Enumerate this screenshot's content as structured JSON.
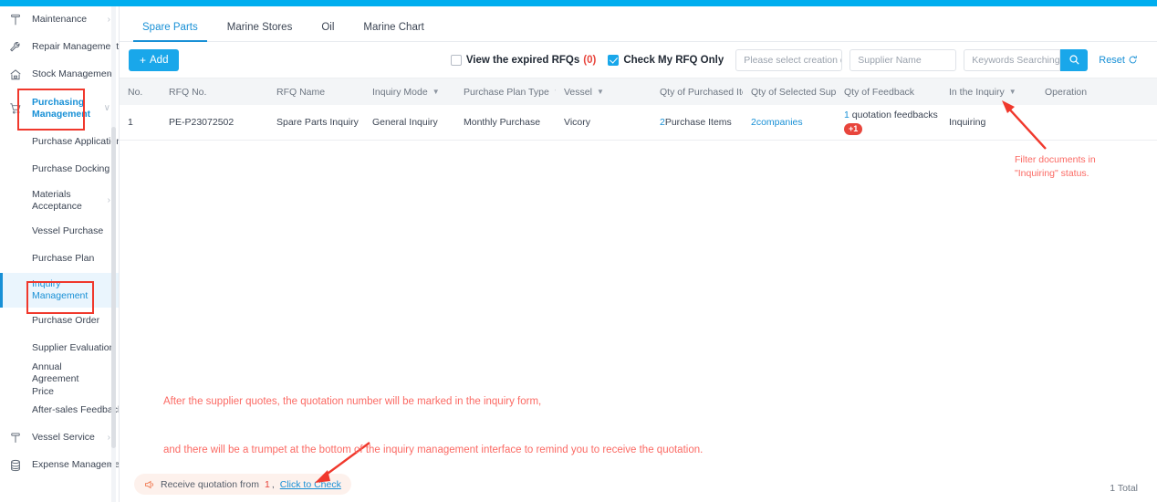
{
  "theme": {
    "accent": "#1890d6",
    "topbar": "#00AEEF",
    "danger": "#e8453c",
    "anno": "#fb6a64"
  },
  "sidebar": {
    "groups": [
      {
        "label": "Maintenance",
        "icon": "hammer-icon",
        "chevron": "›",
        "type": "top"
      },
      {
        "label": "Repair Management",
        "icon": "wrench-icon",
        "chevron": "›",
        "type": "top"
      },
      {
        "label": "Stock Management",
        "icon": "home-icon",
        "chevron": "›",
        "type": "top"
      },
      {
        "label": "Purchasing Management",
        "icon": "cart-icon",
        "chevron": "∨",
        "type": "top-active"
      }
    ],
    "sub_items": [
      {
        "label": "Purchase Application"
      },
      {
        "label": "Purchase Docking"
      },
      {
        "label": "Materials Acceptance",
        "chevron": "›",
        "two_line": true
      },
      {
        "label": "Vessel Purchase"
      },
      {
        "label": "Purchase Plan"
      },
      {
        "label": "Inquiry Management",
        "two_line": true,
        "selected": true
      },
      {
        "label": "Purchase Order"
      },
      {
        "label": "Supplier Evaluation"
      },
      {
        "label": "Annual Agreement Price",
        "two_line": true
      },
      {
        "label": "After-sales Feedback"
      }
    ],
    "bottom_groups": [
      {
        "label": "Vessel Service",
        "icon": "anchor-icon",
        "chevron": "›"
      },
      {
        "label": "Expense Management",
        "icon": "stack-icon",
        "chevron": "›"
      }
    ]
  },
  "tabs": [
    {
      "label": "Spare Parts",
      "active": true
    },
    {
      "label": "Marine Stores",
      "active": false
    },
    {
      "label": "Oil",
      "active": false
    },
    {
      "label": "Marine Chart",
      "active": false
    }
  ],
  "toolbar": {
    "add_label": "Add",
    "add_plus": "+",
    "expired_label": "View the expired RFQs",
    "expired_count": "(0)",
    "expired_checked": false,
    "myrfq_label": "Check My RFQ Only",
    "myrfq_checked": true,
    "date_placeholder": "Please select creation dat",
    "supplier_placeholder": "Supplier Name",
    "keywords_placeholder": "Keywords Searching",
    "search_icon": "search-icon",
    "reset_label": "Reset",
    "reset_icon": "refresh-icon"
  },
  "table": {
    "columns": [
      {
        "key": "no",
        "label": "No.",
        "caret": ""
      },
      {
        "key": "rfqno",
        "label": "RFQ No.",
        "caret": ""
      },
      {
        "key": "name",
        "label": "RFQ Name",
        "caret": ""
      },
      {
        "key": "mode",
        "label": "Inquiry Mode",
        "caret": "▼"
      },
      {
        "key": "ptype",
        "label": "Purchase Plan Type",
        "caret": "▼"
      },
      {
        "key": "vessel",
        "label": "Vessel",
        "caret": "▼"
      },
      {
        "key": "qpi",
        "label": "Qty of Purchased Ite...",
        "caret": ""
      },
      {
        "key": "qss",
        "label": "Qty of Selected Sup...",
        "caret": ""
      },
      {
        "key": "qfb",
        "label": "Qty of Feedback",
        "caret": ""
      },
      {
        "key": "inq",
        "label": "In the Inquiry",
        "caret": "▼"
      },
      {
        "key": "op",
        "label": "Operation",
        "caret": ""
      }
    ],
    "rows": [
      {
        "no": "1",
        "rfqno": "PE-P23072502",
        "name": "Spare Parts Inquiry",
        "mode": "General Inquiry",
        "ptype": "Monthly Purchase",
        "vessel": "Vicory",
        "qpi_num": "2",
        "qpi_text": " Purchase Items",
        "qss": "2companies",
        "qfb_num": "1",
        "qfb_text": " quotation feedbacks",
        "qfb_badge": "+1",
        "inq": "Inquiring",
        "op": ""
      }
    ]
  },
  "annotations": {
    "filter_note_line1": "Filter documents in",
    "filter_note_line2": "\"Inquiring\" status.",
    "center_note_line1": "After the supplier quotes, the quotation number will be marked in the inquiry form,",
    "center_note_line2": "and there will be a trumpet at the bottom of the inquiry management interface to remind you to receive the quotation."
  },
  "footer": {
    "toast_icon": "trumpet-icon",
    "toast_text": "Receive quotation from",
    "toast_num": "1",
    "toast_comma": ",",
    "toast_link": "Click to Check",
    "total": "1 Total"
  }
}
